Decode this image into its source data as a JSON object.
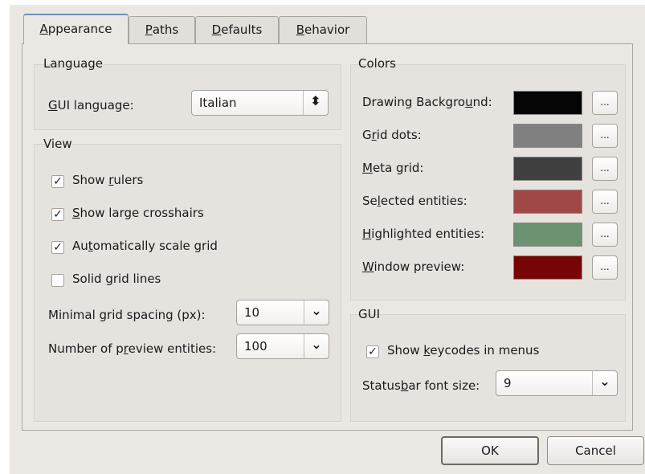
{
  "tabs": [
    {
      "label": "Appearance",
      "mnemonic": "A",
      "rest": "ppearance"
    },
    {
      "label": "Paths",
      "mnemonic": "P",
      "rest": "aths"
    },
    {
      "label": "Defaults",
      "mnemonic": "D",
      "rest": "efaults"
    },
    {
      "label": "Behavior",
      "mnemonic": "B",
      "rest": "ehavior"
    }
  ],
  "language": {
    "title": "Language",
    "gui_language_label": "GUI language:",
    "gui_language_label_parts": {
      "pre": "",
      "mn": "G",
      "post": "UI language:"
    },
    "gui_language_value": "Italian"
  },
  "view": {
    "title": "View",
    "show_rulers": {
      "label": "Show rulers",
      "pre": "Show ",
      "mn": "r",
      "post": "ulers",
      "checked": true,
      "mark": "✓"
    },
    "show_large_crosshairs": {
      "label": "Show large crosshairs",
      "pre": "",
      "mn": "S",
      "post": "how large crosshairs",
      "checked": true,
      "mark": "✓"
    },
    "auto_scale_grid": {
      "label": "Automatically scale grid",
      "pre": "Au",
      "mn": "t",
      "post": "omatically scale grid",
      "checked": true,
      "mark": "✓"
    },
    "solid_grid_lines": {
      "label": "Solid grid lines",
      "pre": "Solid ",
      "mn": "g",
      "post": "rid lines",
      "checked": false
    },
    "min_grid_spacing_label": "Minimal grid spacing (px):",
    "min_grid_spacing_value": "10",
    "preview_entities_label": "Number of preview entities:",
    "preview_entities_parts": {
      "pre": "Number of p",
      "mn": "r",
      "post": "eview entities:"
    },
    "preview_entities_value": "100"
  },
  "colors": {
    "title": "Colors",
    "items": [
      {
        "label": "Drawing Background:",
        "pre": "Drawing Backgro",
        "mn": "u",
        "post": "nd:",
        "color": "#050505"
      },
      {
        "label": "Grid dots:",
        "pre": "G",
        "mn": "r",
        "post": "id dots:",
        "color": "#808080"
      },
      {
        "label": "Meta grid:",
        "pre": "",
        "mn": "M",
        "post": "eta grid:",
        "color": "#404040"
      },
      {
        "label": "Selected entities:",
        "pre": "Se",
        "mn": "l",
        "post": "ected entities:",
        "color": "#a04848"
      },
      {
        "label": "Highlighted entities:",
        "pre": "",
        "mn": "H",
        "post": "ighlighted entities:",
        "color": "#6b9271"
      },
      {
        "label": "Window preview:",
        "pre": "",
        "mn": "W",
        "post": "indow preview:",
        "color": "#760606"
      }
    ],
    "button_label": "..."
  },
  "gui": {
    "title": "GUI",
    "show_keycodes": {
      "label": "Show keycodes in menus",
      "pre": "Show ",
      "mn": "k",
      "post": "eycodes in menus",
      "checked": true,
      "mark": "✓"
    },
    "statusbar_font_size_label": "Statusbar font size:",
    "statusbar_parts": {
      "pre": "Status",
      "mn": "b",
      "post": "ar font size:"
    },
    "statusbar_font_size_value": "9"
  },
  "buttons": {
    "ok": "OK",
    "cancel": "Cancel"
  },
  "icons": {
    "combo_updown": "⬍",
    "combo_down": "⌄"
  }
}
